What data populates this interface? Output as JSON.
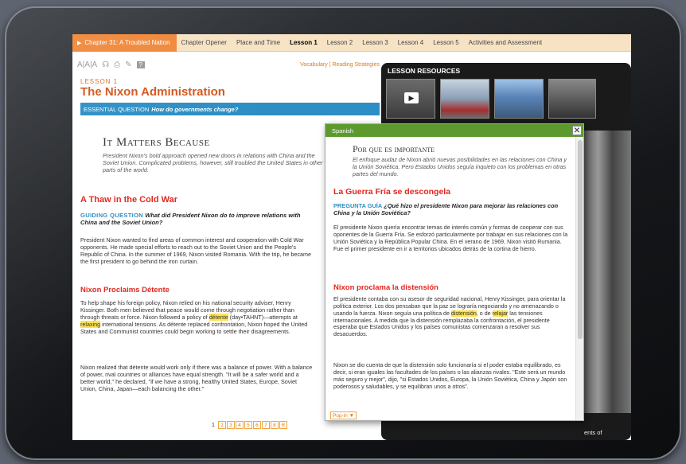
{
  "nav": {
    "chapter": "Chapter 31: A Troubled Nation",
    "tabs": [
      "Chapter Opener",
      "Place and Time",
      "Lesson 1",
      "Lesson 2",
      "Lesson 3",
      "Lesson 4",
      "Lesson 5",
      "Activities and Assessment"
    ],
    "active_tab": "Lesson 1"
  },
  "toolbar": {
    "text_size": "A|A|A",
    "links": "Vocabulary | Reading Strategies"
  },
  "lesson": {
    "number": "LESSON 1",
    "title": "The Nixon Administration",
    "eq_label": "ESSENTIAL QUESTION",
    "eq_text": "How do governments change?",
    "matters_title": "It Matters Because",
    "matters_text": "President Nixon's bold approach opened new doors in relations with China and the Soviet Union. Complicated problems, however, still troubled the United States in other parts of the world.",
    "h1": "A Thaw in the Cold War",
    "gq_label": "GUIDING QUESTION",
    "gq_text": "What did President Nixon do to improve relations with China and the Soviet Union?",
    "p1": "President Nixon wanted to find areas of common interest and cooperation with Cold War opponents. He made special efforts to reach out to the Soviet Union and the People's Republic of China. In the summer of 1969, Nixon visited Romania. With the trip, he became the first president to go behind the iron curtain.",
    "h2": "Nixon Proclaims Détente",
    "p2a": "To help shape his foreign policy, Nixon relied on his national security adviser, Henry Kissinger. Both men believed that peace would come through negotiation rather than through threats or force. Nixon followed a policy of ",
    "p2_hl1": "détente",
    "p2b": " (day•TAHNT)—attempts at ",
    "p2_hl2": "relaxing",
    "p2c": " international tensions. As détente replaced confrontation, Nixon hoped the United States and Communist countries could begin working to settle their disagreements.",
    "p3": "Nixon realized that détente would work only if there was a balance of power. With a balance of power, rival countries or alliances have equal strength. \"It will be a safer world and a better world,\" he declared, \"if we have a strong, healthy United States, Europe, Soviet Union, China, Japan—each balancing the other.\""
  },
  "pager": {
    "current": "1",
    "pages": [
      "2",
      "3",
      "4",
      "5",
      "6",
      "7",
      "8",
      "R"
    ]
  },
  "resources": {
    "title": "LESSON RESOURCES",
    "caption": "ents of"
  },
  "popup": {
    "title": "Spanish",
    "close": "✕",
    "por_title": "Por que es importante",
    "intro": "El enfoque audaz de Nixon abrió nuevas posibilidades en las relaciones con China y la Unión Soviética. Pero Estados Unidos seguía inquieto con los problemas en otras partes del mundo.",
    "h1": "La Guerra Fría se descongela",
    "gq_label": "PREGUNTA GUÍA",
    "gq_text": "¿Qué hizo el presidente Nixon para mejorar las relaciones con China y la Unión Soviética?",
    "p1": "El presidente Nixon quería encontrar temas de interés común y formas de cooperar con sus oponentes de la Guerra Fría. Se esforzó particularmente por trabajar en sus relaciones con la Unión Soviética y la República Popular China. En el verano de 1969, Nixon visitó Rumania. Fue el primer presidente en ir a territorios ubicados detrás de la cortina de hierro.",
    "h2": "Nixon proclama la distensión",
    "p2a": "El presidente contaba con su asesor de seguridad nacional, Henry Kissinger, para orientar la política exterior. Los dos pensaban que la paz se lograría negociando y no amenazando o usando la fuerza. Nixon seguía una política de ",
    "p2_hl1": "distensión",
    "p2b": ", o de ",
    "p2_hl2": "relajar",
    "p2c": " las tensiones internacionales. A medida que la distensión remplazaba la confrontación, el presidente esperaba que Estados Unidos y los países comunistas comenzaran a resolver sus desacuerdos.",
    "p3": "Nixon se dio cuenta de que la distensión solo funcionaría si el poder estaba equilibrado, es decir, si eran iguales las facultades de los países o las alianzas rivales. \"Este será un mundo más seguro y mejor\", dijo, \"si Estados Unidos, Europa, la Unión Soviética, China y Japón son poderosos y saludables, y se equilibran unos a otros\".",
    "popin": "Pop-in ▼"
  }
}
